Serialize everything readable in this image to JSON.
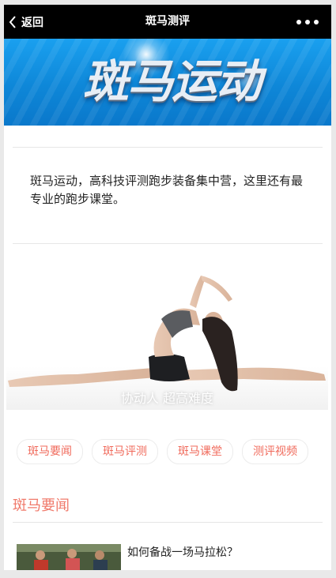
{
  "topbar": {
    "back_label": "返回",
    "title": "斑马测评"
  },
  "banner": {
    "text": "斑马运动"
  },
  "intro": {
    "text": "斑马运动，高科技评测跑步装备集中营，这里还有最专业的跑步课堂。"
  },
  "carousel": {
    "caption": "协动人 超高难度"
  },
  "tabs": [
    {
      "label": "斑马要闻"
    },
    {
      "label": "斑马评测"
    },
    {
      "label": "斑马课堂"
    },
    {
      "label": "测评视频"
    }
  ],
  "section": {
    "title": "斑马要闻"
  },
  "news": [
    {
      "title": "如何备战一场马拉松？"
    }
  ],
  "colors": {
    "accent": "#f06a5b",
    "topbar": "#000000",
    "banner": "#1191e0"
  }
}
